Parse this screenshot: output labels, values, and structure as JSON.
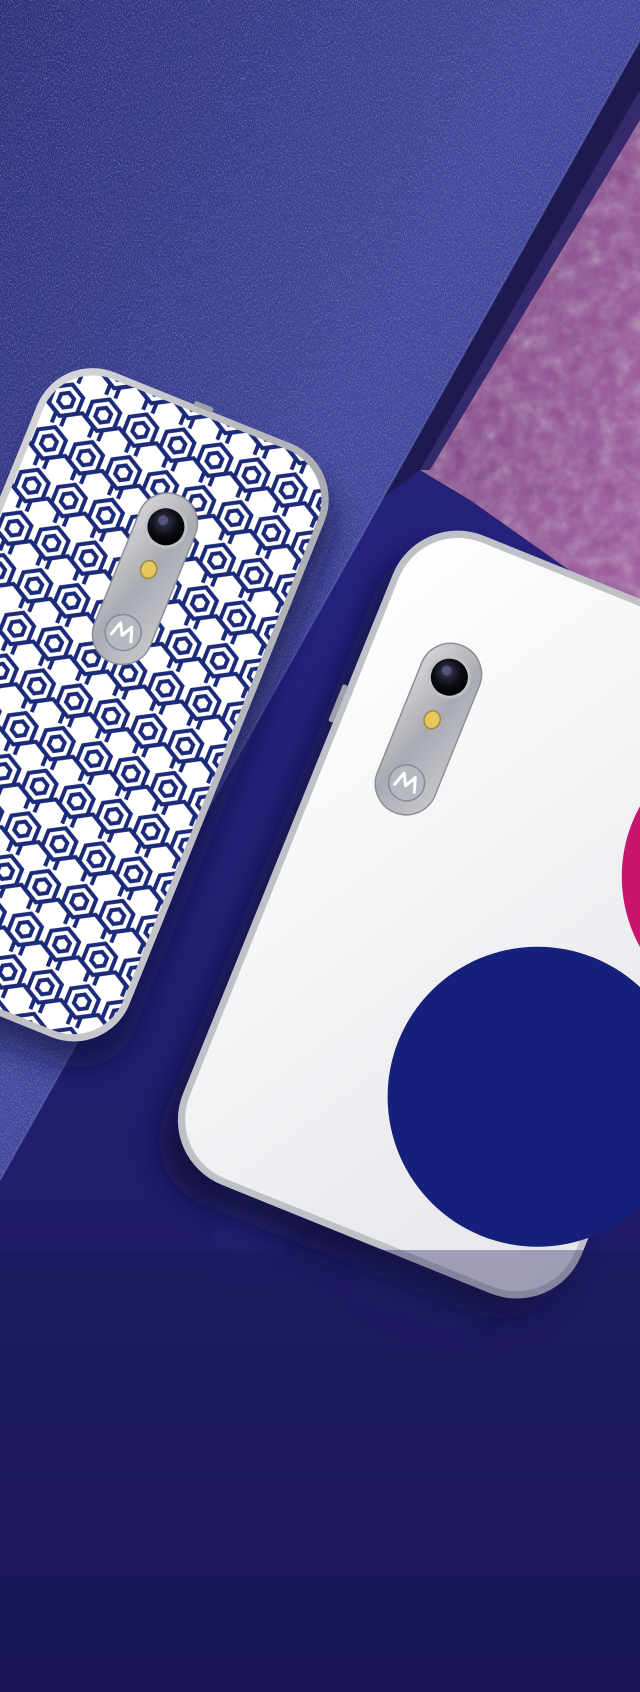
{
  "scene": {
    "subject": "two-phones-on-textured-backgrounds",
    "colors": {
      "denim": "#3f4598",
      "denim_dark": "#2c2f78",
      "leather_purple": "#8e4d93",
      "navy_floor": "#24207a",
      "deep_navy": "#1e1a5c",
      "phone_white": "#f3f3f5",
      "accent_magenta": "#c8136f",
      "accent_navy": "#15207a",
      "hex_pattern": "#1c2a7a"
    },
    "phones": [
      {
        "name": "patterned-back-phone",
        "back": "hexagon-pattern",
        "brand_icon": "motorola-logo-icon"
      },
      {
        "name": "white-back-phone",
        "back": "white-with-color-circles",
        "brand_icon": "motorola-logo-icon"
      }
    ]
  }
}
